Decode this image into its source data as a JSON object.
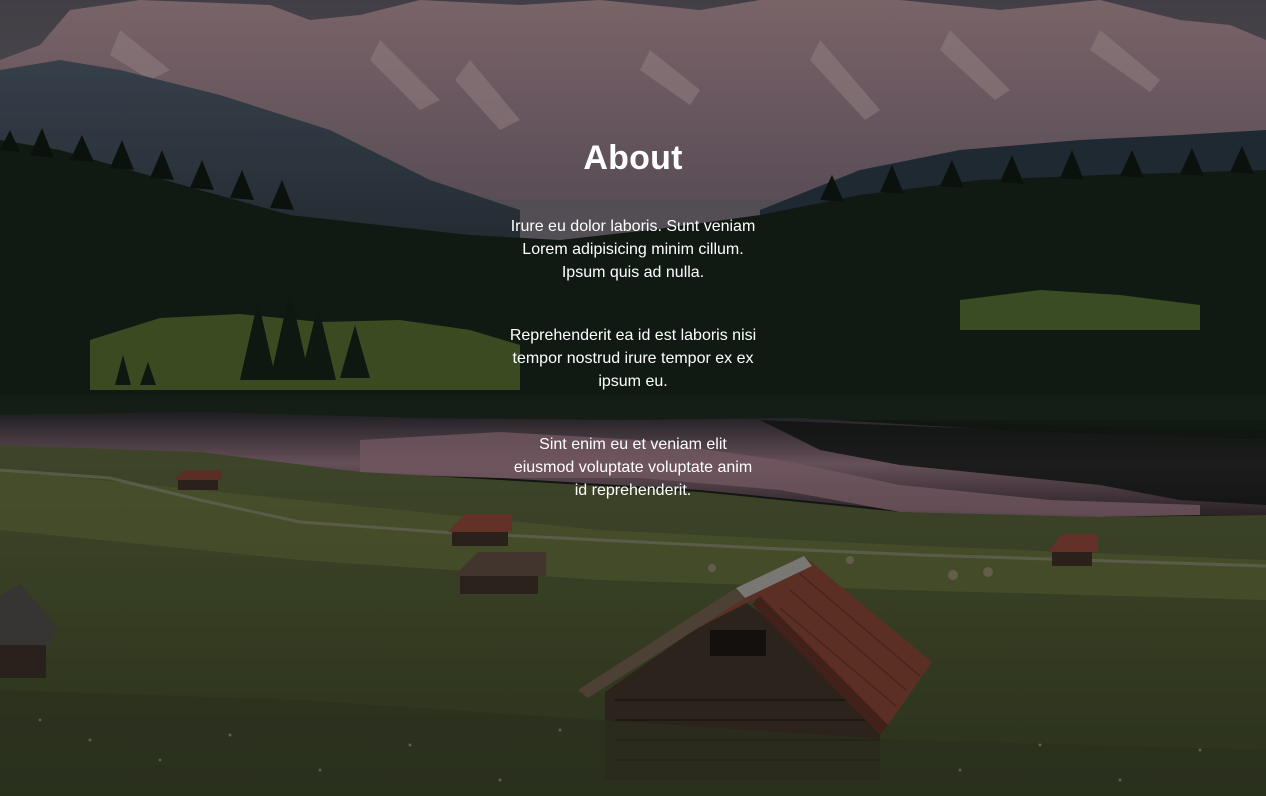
{
  "section": {
    "title": "About",
    "paragraphs": [
      "Irure eu dolor laboris. Sunt veniam Lorem adipisicing minim cillum. Ipsum quis ad nulla.",
      "Reprehenderit ea id est laboris nisi tempor nostrud irure tempor ex ex ipsum eu.",
      "Sint enim eu et veniam elit eiusmod voluptate voluptate anim id reprehenderit."
    ]
  },
  "background": {
    "icon": "mountain-lake-meadow-photo",
    "colors": {
      "sky": "#6b6670",
      "mountains": "#9c7f86",
      "forest": "#16241a",
      "lake": "#8f6f7a",
      "meadow": "#4f5a30",
      "roof": "#8a4636"
    }
  }
}
